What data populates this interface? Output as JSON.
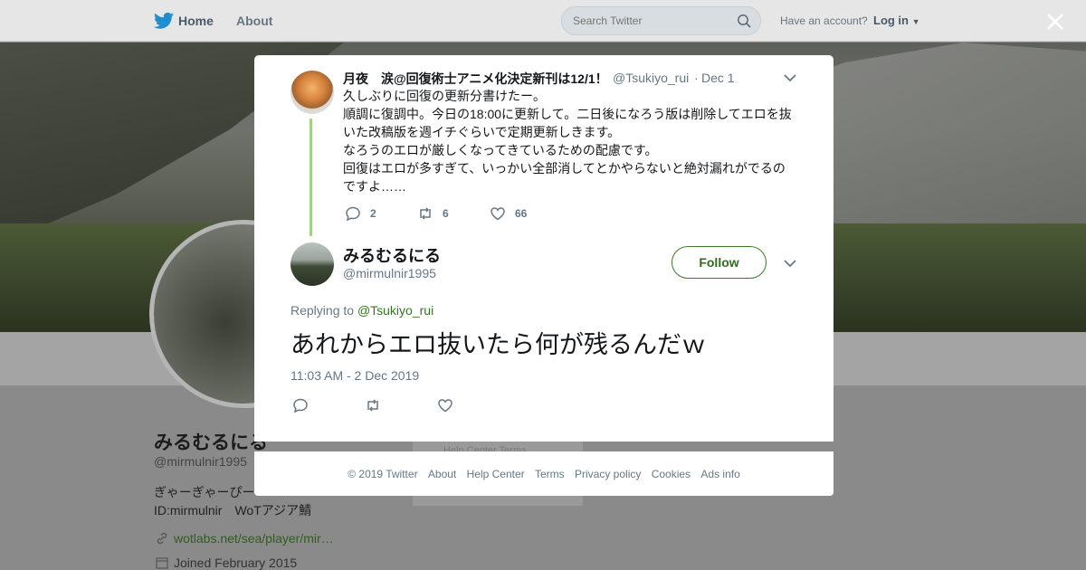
{
  "nav": {
    "home": "Home",
    "about": "About",
    "search_placeholder": "Search Twitter",
    "have_account": "Have an account?",
    "login": "Log in"
  },
  "profile": {
    "name": "みるむるにる",
    "handle": "@mirmulnir1995",
    "bio_line1": "ぎゃーぎゃーぴー",
    "bio_line2": "ID:mirmulnir　WoTアジア鯖",
    "link": "wotlabs.net/sea/player/mir…",
    "joined": "Joined February 2015",
    "ghost_links": "Help Center  Terms"
  },
  "parent_tweet": {
    "name": "月夜　涙@回復術士アニメ化決定新刊は12/1！",
    "handle": "@Tsukiyo_rui",
    "separator": "·",
    "date": "Dec 1",
    "lines": [
      "久しぶりに回復の更新分書けたー。",
      "順調に復調中。今日の18:00に更新して。二日後になろう版は削除してエロを抜",
      "いた改稿版を週イチぐらいで定期更新しきます。",
      "なろうのエロが厳しくなってきているための配慮です。",
      "回復はエロが多すぎて、いっかい全部消してとかやらないと絶対漏れがでるの",
      "ですよ……"
    ],
    "replies": "2",
    "retweets": "6",
    "likes": "66"
  },
  "tweet": {
    "name": "みるむるにる",
    "handle": "@mirmulnir1995",
    "follow": "Follow",
    "replying_to": "Replying to",
    "mention": "@Tsukiyo_rui",
    "text": "あれからエロ抜いたら何が残るんだｗ",
    "timestamp": "11:03 AM - 2 Dec 2019"
  },
  "footer": {
    "copyright": "© 2019 Twitter",
    "about": "About",
    "help": "Help Center",
    "terms": "Terms",
    "privacy": "Privacy policy",
    "cookies": "Cookies",
    "ads": "Ads info"
  },
  "colors": {
    "accent_green": "#2f6a1d",
    "thread_line": "#a5cf8b",
    "twitter_blue": "#1da1f2"
  },
  "icons": [
    "twitter-bird-icon",
    "search-icon",
    "close-icon",
    "chevron-down-icon",
    "reply-icon",
    "retweet-icon",
    "like-icon",
    "link-icon",
    "calendar-icon"
  ]
}
